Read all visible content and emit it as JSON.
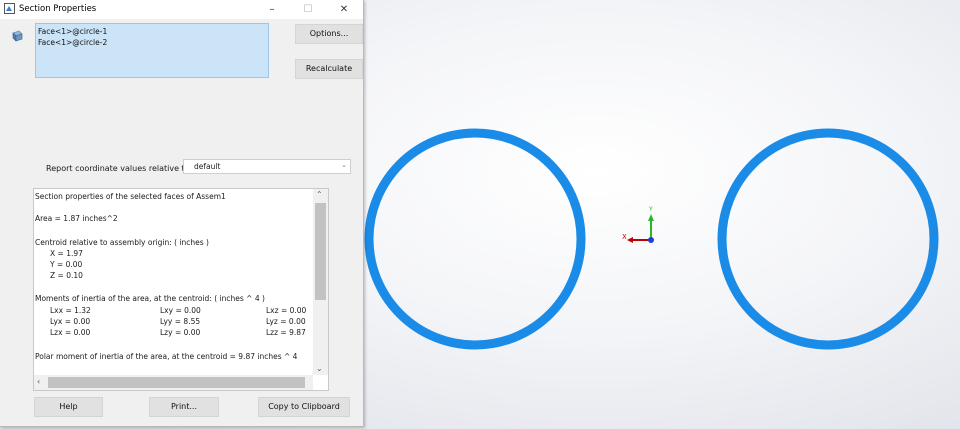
{
  "dialog": {
    "title": "Section Properties",
    "window_controls": {
      "minimize": "–",
      "maximize": "☐",
      "close": "✕"
    },
    "selection_items": [
      "Face<1>@circle-1",
      "Face<1>@circle-2"
    ],
    "options_label": "Options...",
    "recalculate_label": "Recalculate",
    "coord_label": "Report coordinate values relative to:",
    "coord_value": "default",
    "results": {
      "header": "Section properties of the selected faces of Assem1",
      "area": "Area = 1.87 inches^2",
      "centroid_title": "Centroid relative to assembly origin: ( inches )",
      "centroid": [
        "X = 1.97",
        "Y = 0.00",
        "Z = 0.10"
      ],
      "moments_title": "Moments of inertia of the area, at the centroid: ( inches ^ 4 )",
      "moments": [
        [
          "Lxx = 1.32",
          "Lxy = 0.00",
          "Lxz = 0.00"
        ],
        [
          "Lyx = 0.00",
          "Lyy = 8.55",
          "Lyz = 0.00"
        ],
        [
          "Lzx = 0.00",
          "Lzy = 0.00",
          "Lzz = 9.87"
        ]
      ],
      "polar": "Polar moment of inertia of the area, at the centroid = 9.87 inches ^ 4"
    },
    "help_label": "Help",
    "print_label": "Print...",
    "copy_label": "Copy to Clipboard"
  },
  "viewport": {
    "triad": {
      "x_label": "X",
      "y_label": "Y"
    },
    "colors": {
      "ring": "#1a8ce8",
      "x_axis": "#c00000",
      "y_axis": "#2bb52b",
      "z_axis": "#1a3fd1"
    }
  }
}
